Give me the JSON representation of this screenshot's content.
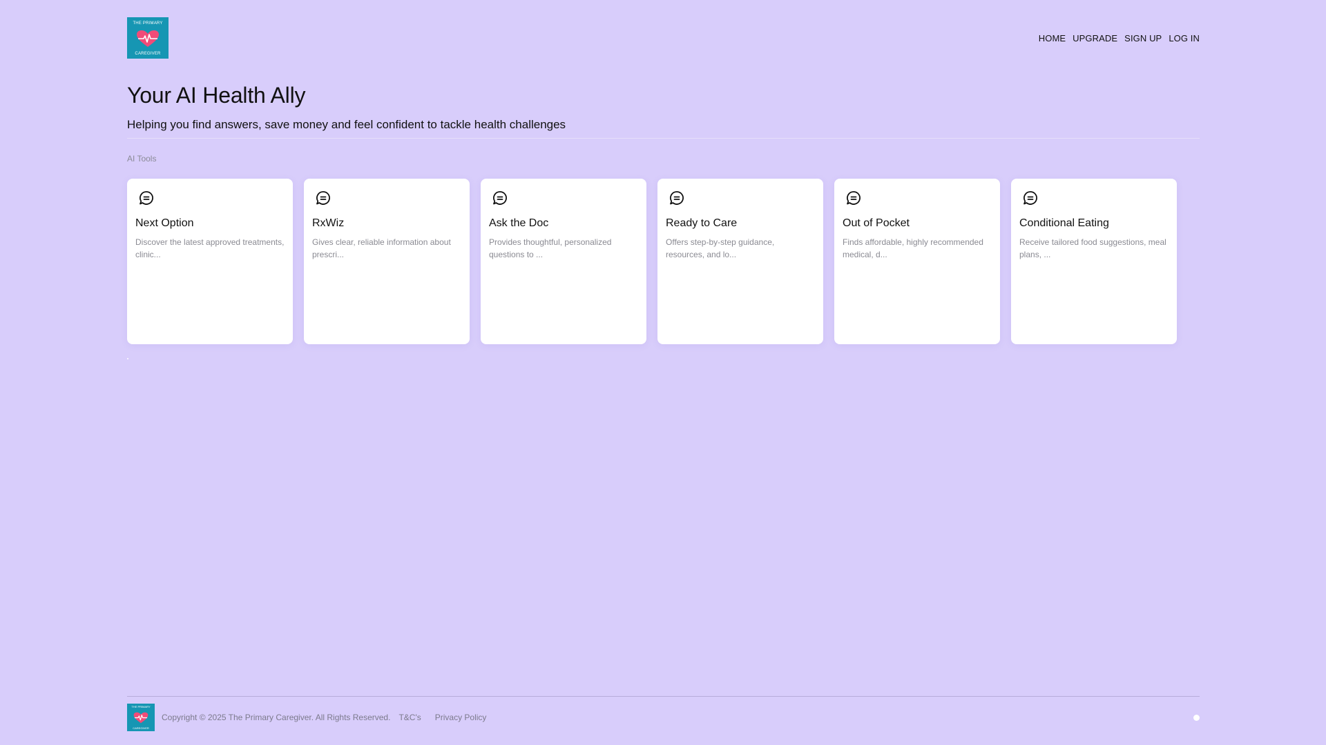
{
  "brand": {
    "logo_top": "THE PRIMARY",
    "logo_bottom": "CAREGIVER",
    "logo_colors": {
      "background": "#1696b3",
      "heart": "#f24b78"
    }
  },
  "nav": {
    "items": [
      "HOME",
      "UPGRADE",
      "SIGN UP",
      "LOG IN"
    ]
  },
  "hero": {
    "title": "Your AI Health Ally",
    "subtitle": "Helping you find answers, save money and feel confident to tackle health challenges"
  },
  "section": {
    "label": "AI Tools"
  },
  "cards": [
    {
      "title": "Next Option",
      "description": "Discover the latest approved treatments, clinic...",
      "icon": "chat-bubble-icon"
    },
    {
      "title": "RxWiz",
      "description": "Gives clear, reliable information about prescri...",
      "icon": "chat-bubble-icon"
    },
    {
      "title": "Ask the Doc",
      "description": "Provides thoughtful, personalized questions to ...",
      "icon": "chat-bubble-icon"
    },
    {
      "title": "Ready to Care",
      "description": "Offers step-by-step guidance, resources, and lo...",
      "icon": "chat-bubble-icon"
    },
    {
      "title": "Out of Pocket",
      "description": "Finds affordable, highly recommended medical, d...",
      "icon": "chat-bubble-icon"
    },
    {
      "title": "Conditional Eating",
      "description": "Receive tailored food suggestions, meal plans, ...",
      "icon": "chat-bubble-icon"
    }
  ],
  "footer": {
    "copyright": "Copyright © 2025 The Primary Caregiver. All Rights Reserved.",
    "links": [
      "T&C's",
      "Privacy Policy"
    ]
  },
  "colors": {
    "page_background": "#d8cdfb",
    "card_background": "#ffffff"
  }
}
